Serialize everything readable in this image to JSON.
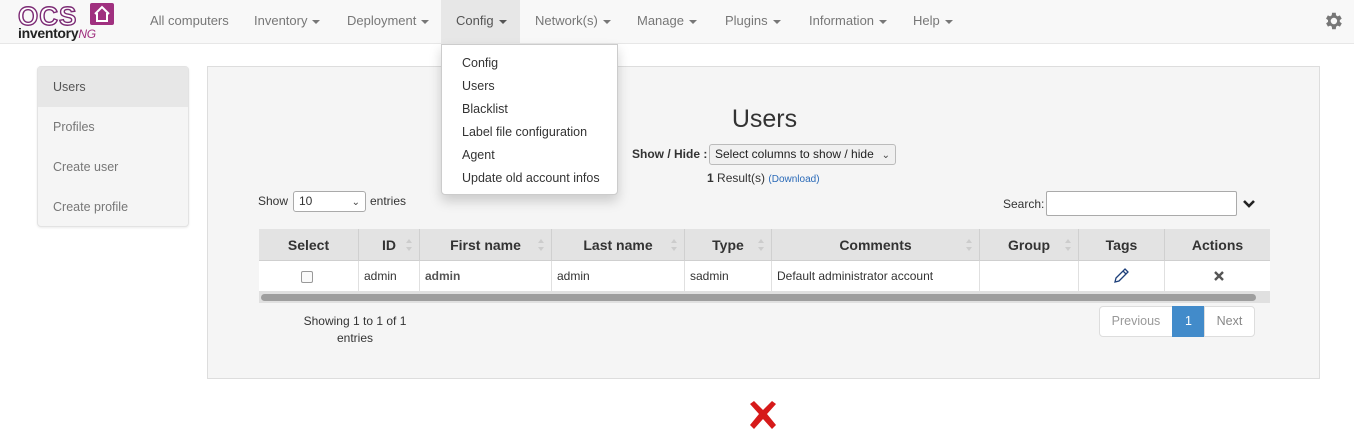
{
  "brand": {
    "logo_text": "OCS inventory NG",
    "accent": "#a0307f"
  },
  "nav": {
    "items": [
      {
        "label": "All computers",
        "has_caret": false
      },
      {
        "label": "Inventory",
        "has_caret": true
      },
      {
        "label": "Deployment",
        "has_caret": true
      },
      {
        "label": "Config",
        "has_caret": true,
        "active": true
      },
      {
        "label": "Network(s)",
        "has_caret": true
      },
      {
        "label": "Manage",
        "has_caret": true
      },
      {
        "label": "Plugins",
        "has_caret": true
      },
      {
        "label": "Information",
        "has_caret": true
      },
      {
        "label": "Help",
        "has_caret": true
      }
    ],
    "settings_icon": "gear-icon"
  },
  "config_menu": {
    "items": [
      "Config",
      "Users",
      "Blacklist",
      "Label file configuration",
      "Agent",
      "Update old account infos"
    ]
  },
  "sidebar": {
    "items": [
      {
        "label": "Users",
        "active": true
      },
      {
        "label": "Profiles"
      },
      {
        "label": "Create user"
      },
      {
        "label": "Create profile"
      }
    ]
  },
  "main": {
    "title": "Users",
    "show_hide_label": "Show / Hide :",
    "columns_select": "Select columns to show / hide",
    "results_count": "1",
    "results_label": "Result(s)",
    "download_label": "(Download)",
    "length_prefix": "Show",
    "length_value": "10",
    "length_suffix": "entries",
    "search_label": "Search:",
    "search_value": "",
    "table": {
      "headers": [
        "Select",
        "ID",
        "First name",
        "Last name",
        "Type",
        "Comments",
        "Group",
        "Tags",
        "Actions"
      ],
      "rows": [
        {
          "id": "admin",
          "first_name": "admin",
          "last_name": "admin",
          "type": "sadmin",
          "comments": "Default administrator account",
          "group": "",
          "tags_icon": "pencil-icon",
          "action_icon": "delete-icon"
        }
      ]
    },
    "info_line1": "Showing 1 to 1 of 1",
    "info_line2": "entries",
    "pagination": {
      "previous": "Previous",
      "current": "1",
      "next": "Next"
    }
  },
  "footer": {
    "status_icon": "red-x-icon"
  }
}
